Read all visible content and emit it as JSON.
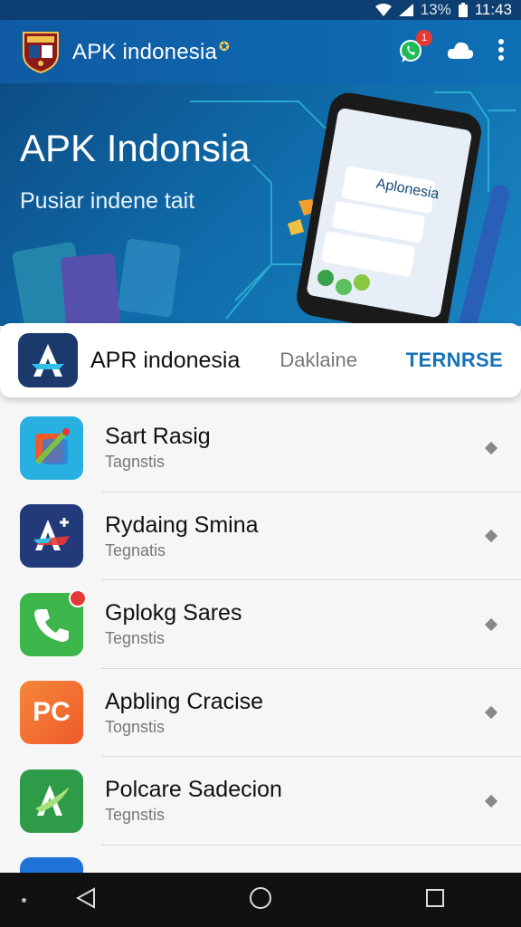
{
  "status_bar": {
    "battery": "13%",
    "time": "11:43"
  },
  "app_bar": {
    "title": "APK indonesia",
    "mark": "✪",
    "notification_count": "1"
  },
  "banner": {
    "title": "APK Indonsia",
    "subtitle": "Pusiar indene tait",
    "phone_screen_title": "Aplonesia"
  },
  "featured": {
    "name": "APR indonesia",
    "subtitle": "Daklaine",
    "action": "TERNRSE"
  },
  "list": [
    {
      "title": "Sart Rasig",
      "subtitle": "Tagnstis",
      "icon": "color-swatch-icon",
      "color": "#27b0e0"
    },
    {
      "title": "Rydaing Smina",
      "subtitle": "Tegnatis",
      "icon": "a-plus-icon",
      "color": "#22397a"
    },
    {
      "title": "Gplokg Sares",
      "subtitle": "Tegnstis",
      "icon": "phone-icon",
      "color": "#3cb54a"
    },
    {
      "title": "Apbling Cracise",
      "subtitle": "Tognstis",
      "icon": "pc-icon",
      "label": "PC",
      "color": "#f26a2e"
    },
    {
      "title": "Polcare Sadecion",
      "subtitle": "Tegnstis",
      "icon": "a-leaf-icon",
      "color": "#2e9b48"
    }
  ],
  "colors": {
    "app_bar": "#0f5aa3",
    "accent": "#1673b8",
    "status_bar": "#0d3f72"
  }
}
